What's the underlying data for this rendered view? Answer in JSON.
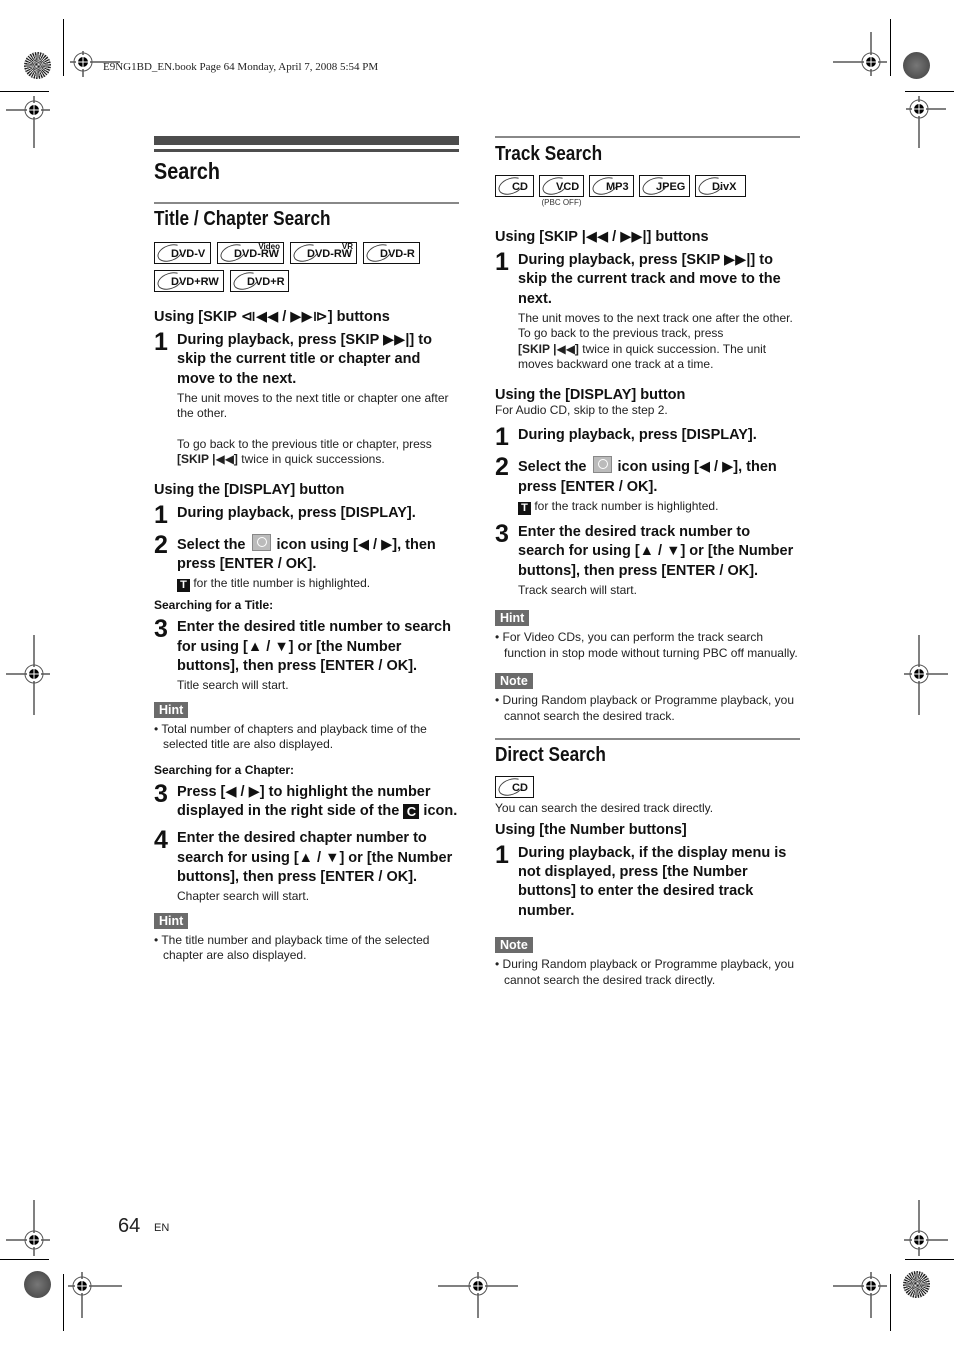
{
  "print_header": "E9NG1BD_EN.book  Page 64  Monday, April 7, 2008  5:54 PM",
  "page_title": "Search",
  "title_chapter": {
    "heading": "Title / Chapter Search",
    "badges": [
      {
        "label": "DVD-V",
        "sup": ""
      },
      {
        "label": "DVD-RW",
        "sup": "Video"
      },
      {
        "label": "DVD-RW",
        "sup": "VR"
      },
      {
        "label": "DVD-R",
        "sup": ""
      },
      {
        "label": "DVD+RW",
        "sup": ""
      },
      {
        "label": "DVD+R",
        "sup": ""
      }
    ],
    "skip_heading": "Using [SKIP ⧏◀◀ / ▶▶⧐] buttons",
    "skip_step1": "During playback, press [SKIP ▶▶|] to skip the current title or chapter and move to the next.",
    "skip_step1_desc1": "The unit moves to the next title or chapter one after the other.",
    "skip_step1_desc2_bold": "[SKIP |◀◀]",
    "skip_step1_desc2_pre": "To go back to the previous title or chapter, press",
    "skip_step1_desc2_post": " twice in quick successions.",
    "display_heading": "Using the [DISPLAY] button",
    "display_step1": "During playback, press [DISPLAY].",
    "display_step2_pre": "Select the",
    "display_step2_post": "icon using [◀ / ▶], then press [ENTER / OK].",
    "display_step2_desc": "for the title number is highlighted.",
    "t_icon": "T",
    "searching_title": "Searching for a Title:",
    "title_step3": "Enter the desired title number to search for using [▲ / ▼] or [the Number buttons], then press [ENTER / OK].",
    "title_step3_desc": "Title search will start.",
    "hint1_label": "Hint",
    "hint1_text": "Total number of chapters and playback time of the selected title are also displayed.",
    "searching_chapter": "Searching for a Chapter:",
    "chapter_step3_pre": "Press [◀ / ▶] to highlight the number displayed in the right side of the",
    "chapter_step3_post": "icon.",
    "c_icon": "C",
    "chapter_step4": "Enter the desired chapter number to search for using [▲ / ▼] or [the Number buttons], then press [ENTER / OK].",
    "chapter_step4_desc": "Chapter search will start.",
    "hint2_label": "Hint",
    "hint2_text": "The title number and playback time of the selected chapter are also displayed."
  },
  "track": {
    "heading": "Track Search",
    "badges": [
      {
        "label": "CD",
        "sub": ""
      },
      {
        "label": "VCD",
        "sub": "(PBC OFF)"
      },
      {
        "label": "MP3",
        "sub": ""
      },
      {
        "label": "JPEG",
        "sub": ""
      },
      {
        "label": "DivX",
        "sub": ""
      }
    ],
    "skip_heading": "Using [SKIP |◀◀ / ▶▶|] buttons",
    "skip_step1": "During playback, press [SKIP ▶▶|] to skip the current track and move to the next.",
    "skip_step1_desc1": "The unit moves to the next track one after the other.",
    "skip_step1_desc2_pre": "To go back to the previous track, press",
    "skip_step1_desc2_bold": "[SKIP |◀◀]",
    "skip_step1_desc2_post": " twice in quick succession. The unit moves backward one track at a time.",
    "display_heading": "Using the [DISPLAY] button",
    "display_note": "For Audio CD, skip to the step 2.",
    "display_step1": "During playback, press [DISPLAY].",
    "display_step2_pre": "Select the",
    "display_step2_post": "icon using [◀ / ▶], then press [ENTER / OK].",
    "display_step2_desc": "for the track number is highlighted.",
    "t_icon": "T",
    "step3": "Enter the desired track number to search for using [▲ / ▼] or [the Number buttons], then press [ENTER / OK].",
    "step3_desc": "Track search will start.",
    "hint_label": "Hint",
    "hint_text": "For Video CDs, you can perform the track search function in stop mode without turning PBC off manually.",
    "note_label": "Note",
    "note_text": "During Random playback or Programme playback, you cannot search the desired track."
  },
  "direct": {
    "heading": "Direct Search",
    "badge": "CD",
    "intro": "You can search the desired track directly.",
    "number_heading": "Using [the Number buttons]",
    "step1": "During playback, if the display menu is not displayed, press [the Number buttons] to enter the desired track number.",
    "note_label": "Note",
    "note_text": "During Random playback or Programme playback, you cannot search the desired track directly."
  },
  "step_numbers": [
    "1",
    "2",
    "3",
    "4"
  ],
  "bullet": "•",
  "footer": {
    "page_number": "64",
    "language": "EN"
  }
}
